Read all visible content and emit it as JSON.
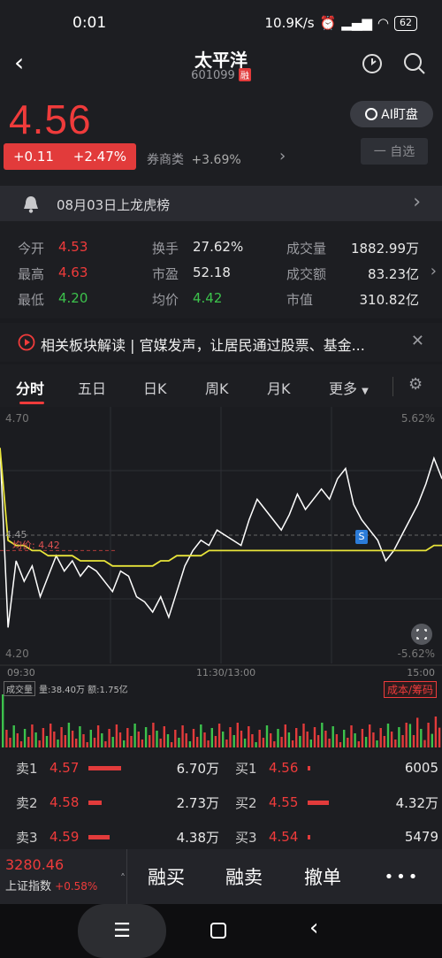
{
  "status_bar": {
    "time": "0:01",
    "speed": "10.9K/s",
    "battery": "62"
  },
  "header": {
    "title": "太平洋",
    "code": "601099",
    "tag": "融"
  },
  "price": {
    "current": "4.56",
    "change": "+0.11",
    "change_pct": "+2.47%",
    "sector_label": "券商类",
    "sector_pct": "+3.69%",
    "ai_button": "AI盯盘",
    "watch_button": "一 自选"
  },
  "banner": {
    "text": "08月03日上龙虎榜"
  },
  "stats": {
    "open_label": "今开",
    "open": "4.53",
    "high_label": "最高",
    "high": "4.63",
    "low_label": "最低",
    "low": "4.20",
    "turnover_label": "换手",
    "turnover": "27.62%",
    "pe_label": "市盈",
    "pe": "52.18",
    "avg_label": "均价",
    "avg": "4.42",
    "volume_label": "成交量",
    "volume": "1882.99万",
    "amount_label": "成交额",
    "amount": "83.23亿",
    "mcap_label": "市值",
    "mcap": "310.82亿"
  },
  "news": {
    "text": "相关板块解读 | 官媒发声，让居民通过股票、基金..."
  },
  "tabs": [
    {
      "label": "分时"
    },
    {
      "label": "五日"
    },
    {
      "label": "日K"
    },
    {
      "label": "周K"
    },
    {
      "label": "月K"
    },
    {
      "label": "更多"
    }
  ],
  "chart": {
    "y_top": "4.70",
    "y_bottom": "4.20",
    "pct_top": "5.62%",
    "pct_bottom": "-5.62%",
    "y_mid": "4.45",
    "avg_label": "均价: 4.42",
    "x_start": "09:30",
    "x_mid": "11:30/13:00",
    "x_end": "15:00",
    "marker": "S",
    "volume_selector": "成交量",
    "volume_info": "量:38.40万 额:1.75亿",
    "cost_button": "成本/筹码"
  },
  "chart_data": {
    "type": "line",
    "title": "",
    "xlabel": "",
    "ylabel": "",
    "ylim": [
      4.2,
      4.7
    ],
    "series": [
      {
        "name": "",
        "color": "#ffffff",
        "values": [
          4.62,
          4.27,
          4.4,
          4.36,
          4.39,
          4.33,
          4.37,
          4.41,
          4.38,
          4.4,
          4.37,
          4.39,
          4.38,
          4.36,
          4.34,
          4.38,
          4.37,
          4.33,
          4.32,
          4.3,
          4.33,
          4.29,
          4.34,
          4.39,
          4.42,
          4.44,
          4.43,
          4.46,
          4.45,
          4.44,
          4.43,
          4.48,
          4.52,
          4.5,
          4.48,
          4.46,
          4.49,
          4.53,
          4.5,
          4.52,
          4.54,
          4.52,
          4.56,
          4.58,
          4.51,
          4.48,
          4.46,
          4.44,
          4.4,
          4.42,
          4.45,
          4.48,
          4.51,
          4.55,
          4.6,
          4.56
        ]
      },
      {
        "name": "均价",
        "color": "#e8e43a",
        "values": [
          4.62,
          4.44,
          4.43,
          4.43,
          4.42,
          4.42,
          4.41,
          4.41,
          4.41,
          4.41,
          4.4,
          4.4,
          4.4,
          4.4,
          4.39,
          4.39,
          4.39,
          4.39,
          4.39,
          4.39,
          4.4,
          4.4,
          4.41,
          4.41,
          4.41,
          4.41,
          4.42,
          4.42,
          4.42,
          4.42,
          4.42,
          4.42,
          4.42,
          4.42,
          4.42,
          4.42,
          4.42,
          4.42,
          4.42,
          4.42,
          4.42,
          4.42,
          4.42,
          4.42,
          4.42,
          4.42,
          4.42,
          4.42,
          4.42,
          4.42,
          4.42,
          4.42,
          4.42,
          4.42,
          4.43,
          4.43
        ]
      }
    ],
    "grid": true
  },
  "book": {
    "sell": [
      {
        "label": "卖1",
        "price": "4.57",
        "vol": "6.70万",
        "bar": 0.34
      },
      {
        "label": "卖2",
        "price": "4.58",
        "vol": "2.73万",
        "bar": 0.14
      },
      {
        "label": "卖3",
        "price": "4.59",
        "vol": "4.38万",
        "bar": 0.22
      }
    ],
    "buy": [
      {
        "label": "买1",
        "price": "4.56",
        "vol": "6005",
        "bar": 0.03
      },
      {
        "label": "买2",
        "price": "4.55",
        "vol": "4.32万",
        "bar": 0.22
      },
      {
        "label": "买3",
        "price": "4.54",
        "vol": "5479",
        "bar": 0.03
      }
    ]
  },
  "tradebar": {
    "index_value": "3280.46",
    "index_name": "上证指数",
    "index_pct": "+0.58%",
    "buy_margin": "融买",
    "sell_margin": "融卖",
    "cancel": "撤单",
    "more": "•••"
  },
  "colors": {
    "up": "#ef3b3b",
    "down": "#3cc24c",
    "accent": "#e23b3b"
  }
}
